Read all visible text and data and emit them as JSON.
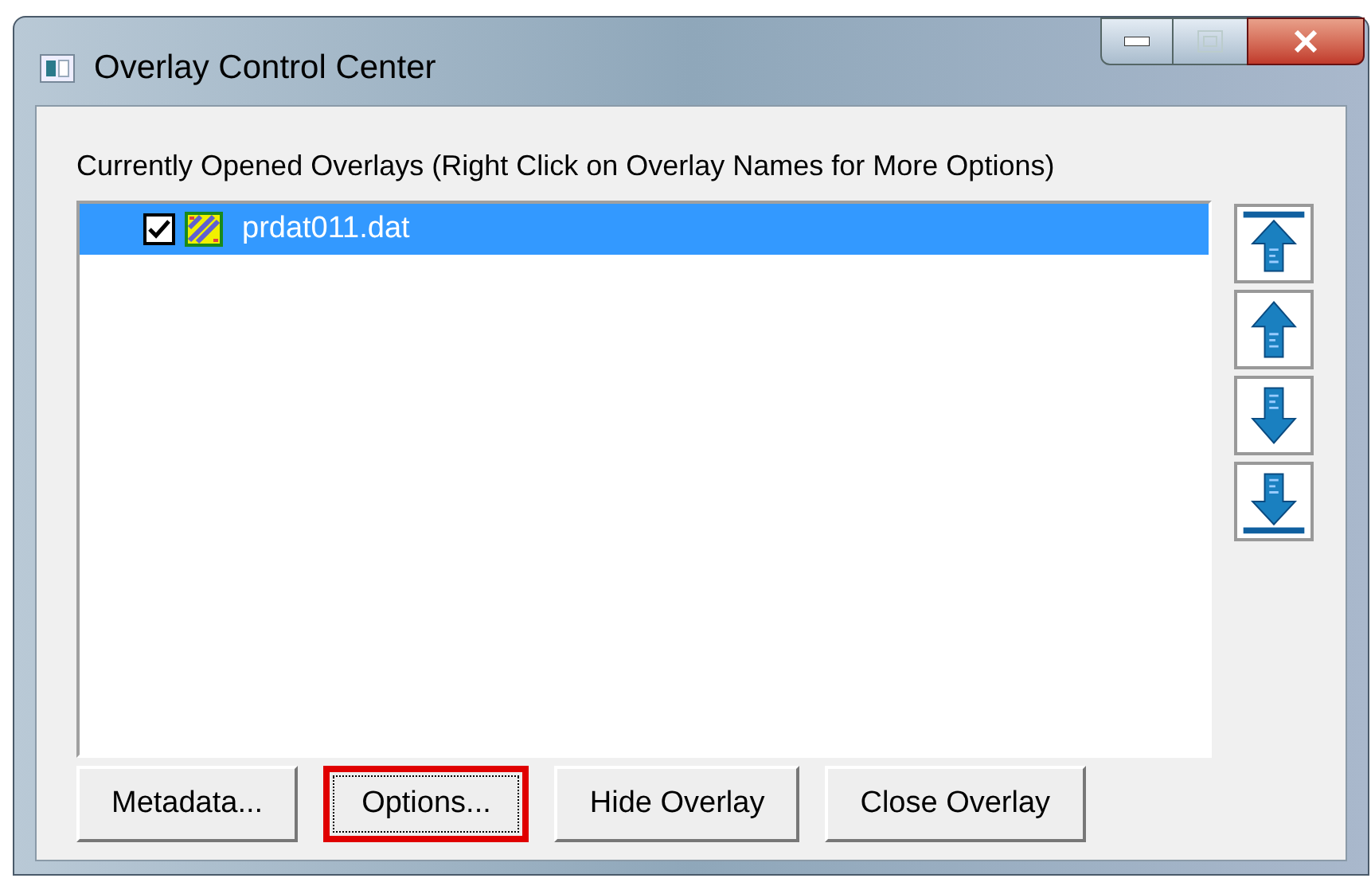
{
  "window": {
    "title": "Overlay Control Center"
  },
  "list_label": "Currently Opened Overlays (Right Click on Overlay Names for More Options)",
  "overlays": [
    {
      "name": "prdat011.dat",
      "checked": true,
      "selected": true
    }
  ],
  "move_buttons": [
    {
      "kind": "top"
    },
    {
      "kind": "up"
    },
    {
      "kind": "down"
    },
    {
      "kind": "bottom"
    }
  ],
  "buttons": [
    {
      "label": "Metadata...",
      "highlighted": false
    },
    {
      "label": "Options...",
      "highlighted": true
    },
    {
      "label": "Hide Overlay",
      "highlighted": false
    },
    {
      "label": "Close Overlay",
      "highlighted": false
    }
  ]
}
